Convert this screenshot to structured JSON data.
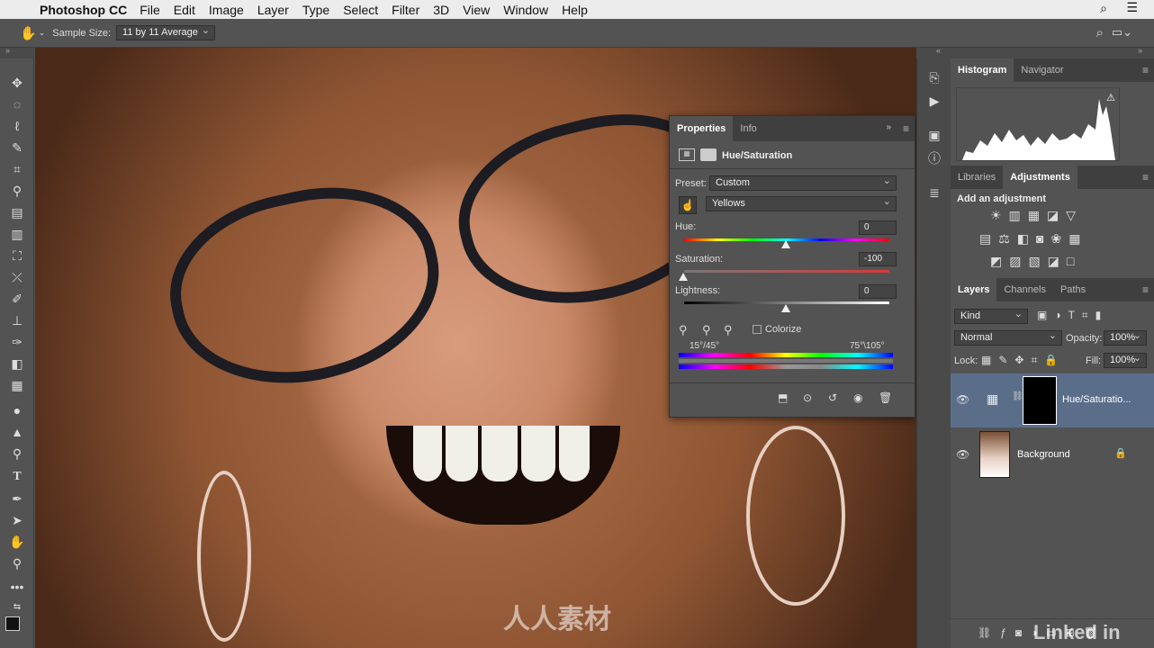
{
  "menubar": {
    "app": "Photoshop CC",
    "items": [
      "File",
      "Edit",
      "Image",
      "Layer",
      "Type",
      "Select",
      "Filter",
      "3D",
      "View",
      "Window",
      "Help"
    ]
  },
  "options": {
    "sample_label": "Sample Size:",
    "sample_value": "11 by 11 Average"
  },
  "properties": {
    "tabs": [
      "Properties",
      "Info"
    ],
    "adjustment_title": "Hue/Saturation",
    "preset_label": "Preset:",
    "preset_value": "Custom",
    "channel_value": "Yellows",
    "hue_label": "Hue:",
    "hue_value": "0",
    "saturation_label": "Saturation:",
    "saturation_value": "-100",
    "lightness_label": "Lightness:",
    "lightness_value": "0",
    "colorize_label": "Colorize",
    "range_left": "15°/45°",
    "range_right": "75°\\105°"
  },
  "histogram": {
    "tabs": [
      "Histogram",
      "Navigator"
    ]
  },
  "adjustments": {
    "tabs": [
      "Libraries",
      "Adjustments"
    ],
    "add_label": "Add an adjustment"
  },
  "layers": {
    "tabs": [
      "Layers",
      "Channels",
      "Paths"
    ],
    "kind_value": "Kind",
    "blend_value": "Normal",
    "opacity_label": "Opacity:",
    "opacity_value": "100%",
    "lock_label": "Lock:",
    "fill_label": "Fill:",
    "fill_value": "100%",
    "items": [
      {
        "name": "Hue/Saturatio..."
      },
      {
        "name": "Background"
      }
    ]
  },
  "watermark": {
    "brand": "人人素材",
    "linkedin": "Linked in"
  }
}
